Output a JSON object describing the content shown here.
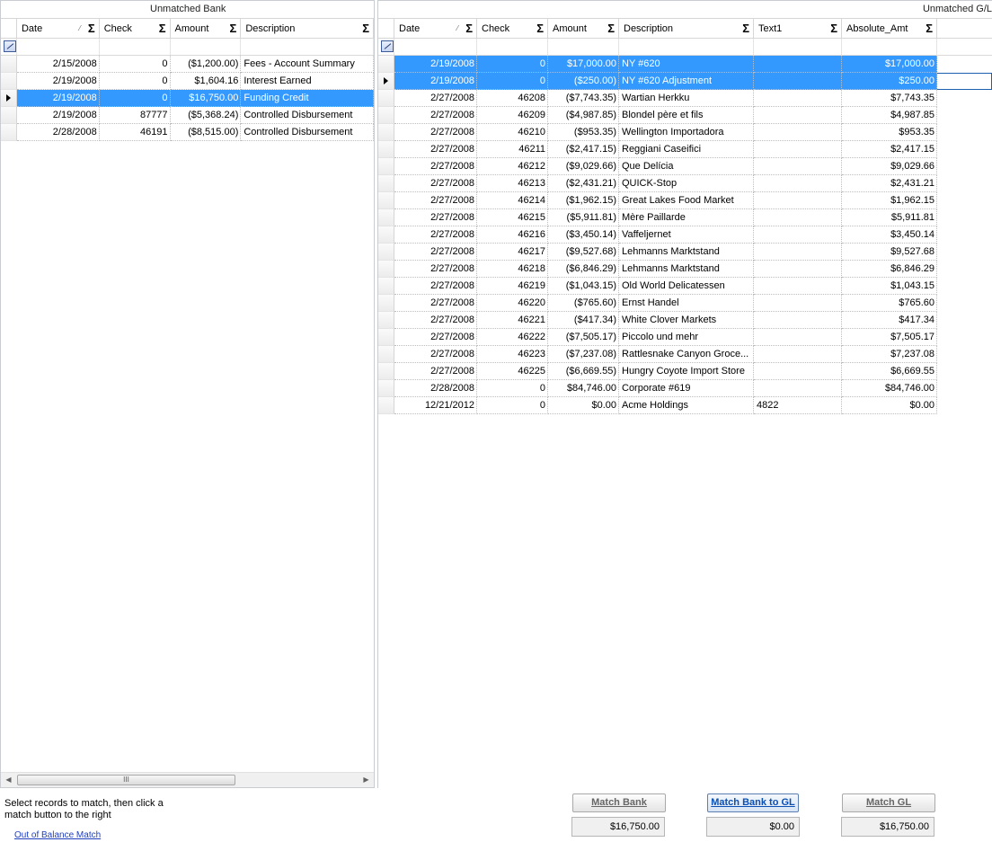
{
  "bank": {
    "title": "Unmatched Bank",
    "columns": [
      {
        "label": "Date",
        "sort": "⁄"
      },
      {
        "label": "Check",
        "sort": ""
      },
      {
        "label": "Amount",
        "sort": ""
      },
      {
        "label": "Description",
        "sort": ""
      }
    ],
    "sum_glyph": "Σ",
    "rows": [
      {
        "date": "2/15/2008",
        "check": "0",
        "amount": "($1,200.00)",
        "description": "Fees - Account Summary",
        "selected": false,
        "current": false
      },
      {
        "date": "2/19/2008",
        "check": "0",
        "amount": "$1,604.16",
        "description": "Interest Earned",
        "selected": false,
        "current": false
      },
      {
        "date": "2/19/2008",
        "check": "0",
        "amount": "$16,750.00",
        "description": "Funding Credit",
        "selected": true,
        "current": true
      },
      {
        "date": "2/19/2008",
        "check": "87777",
        "amount": "($5,368.24)",
        "description": "Controlled Disbursement",
        "selected": false,
        "current": false
      },
      {
        "date": "2/28/2008",
        "check": "46191",
        "amount": "($8,515.00)",
        "description": "Controlled Disbursement",
        "selected": false,
        "current": false
      }
    ],
    "scroll_thumb": "III"
  },
  "gl": {
    "title": "Unmatched G/L",
    "columns": [
      {
        "label": "Date",
        "sort": "⁄"
      },
      {
        "label": "Check",
        "sort": ""
      },
      {
        "label": "Amount",
        "sort": ""
      },
      {
        "label": "Description",
        "sort": ""
      },
      {
        "label": "Text1",
        "sort": ""
      },
      {
        "label": "Absolute_Amt",
        "sort": ""
      }
    ],
    "sum_glyph": "Σ",
    "rows": [
      {
        "date": "2/19/2008",
        "check": "0",
        "amount": "$17,000.00",
        "description": "NY #620",
        "text1": "",
        "abs": "$17,000.00",
        "selected": true,
        "current": false
      },
      {
        "date": "2/19/2008",
        "check": "0",
        "amount": "($250.00)",
        "description": "NY #620 Adjustment",
        "text1": "",
        "abs": "$250.00",
        "selected": true,
        "current": true
      },
      {
        "date": "2/27/2008",
        "check": "46208",
        "amount": "($7,743.35)",
        "description": "Wartian Herkku",
        "text1": "",
        "abs": "$7,743.35",
        "selected": false,
        "current": false
      },
      {
        "date": "2/27/2008",
        "check": "46209",
        "amount": "($4,987.85)",
        "description": "Blondel père et fils",
        "text1": "",
        "abs": "$4,987.85",
        "selected": false,
        "current": false
      },
      {
        "date": "2/27/2008",
        "check": "46210",
        "amount": "($953.35)",
        "description": "Wellington Importadora",
        "text1": "",
        "abs": "$953.35",
        "selected": false,
        "current": false
      },
      {
        "date": "2/27/2008",
        "check": "46211",
        "amount": "($2,417.15)",
        "description": "Reggiani Caseifici",
        "text1": "",
        "abs": "$2,417.15",
        "selected": false,
        "current": false
      },
      {
        "date": "2/27/2008",
        "check": "46212",
        "amount": "($9,029.66)",
        "description": "Que Delícia",
        "text1": "",
        "abs": "$9,029.66",
        "selected": false,
        "current": false
      },
      {
        "date": "2/27/2008",
        "check": "46213",
        "amount": "($2,431.21)",
        "description": "QUICK-Stop",
        "text1": "",
        "abs": "$2,431.21",
        "selected": false,
        "current": false
      },
      {
        "date": "2/27/2008",
        "check": "46214",
        "amount": "($1,962.15)",
        "description": "Great Lakes Food Market",
        "text1": "",
        "abs": "$1,962.15",
        "selected": false,
        "current": false
      },
      {
        "date": "2/27/2008",
        "check": "46215",
        "amount": "($5,911.81)",
        "description": "Mère Paillarde",
        "text1": "",
        "abs": "$5,911.81",
        "selected": false,
        "current": false
      },
      {
        "date": "2/27/2008",
        "check": "46216",
        "amount": "($3,450.14)",
        "description": "Vaffeljernet",
        "text1": "",
        "abs": "$3,450.14",
        "selected": false,
        "current": false
      },
      {
        "date": "2/27/2008",
        "check": "46217",
        "amount": "($9,527.68)",
        "description": "Lehmanns Marktstand",
        "text1": "",
        "abs": "$9,527.68",
        "selected": false,
        "current": false
      },
      {
        "date": "2/27/2008",
        "check": "46218",
        "amount": "($6,846.29)",
        "description": "Lehmanns Marktstand",
        "text1": "",
        "abs": "$6,846.29",
        "selected": false,
        "current": false
      },
      {
        "date": "2/27/2008",
        "check": "46219",
        "amount": "($1,043.15)",
        "description": "Old World Delicatessen",
        "text1": "",
        "abs": "$1,043.15",
        "selected": false,
        "current": false
      },
      {
        "date": "2/27/2008",
        "check": "46220",
        "amount": "($765.60)",
        "description": "Ernst Handel",
        "text1": "",
        "abs": "$765.60",
        "selected": false,
        "current": false
      },
      {
        "date": "2/27/2008",
        "check": "46221",
        "amount": "($417.34)",
        "description": "White Clover Markets",
        "text1": "",
        "abs": "$417.34",
        "selected": false,
        "current": false
      },
      {
        "date": "2/27/2008",
        "check": "46222",
        "amount": "($7,505.17)",
        "description": "Piccolo und mehr",
        "text1": "",
        "abs": "$7,505.17",
        "selected": false,
        "current": false
      },
      {
        "date": "2/27/2008",
        "check": "46223",
        "amount": "($7,237.08)",
        "description": "Rattlesnake Canyon Groce...",
        "text1": "",
        "abs": "$7,237.08",
        "selected": false,
        "current": false
      },
      {
        "date": "2/27/2008",
        "check": "46225",
        "amount": "($6,669.55)",
        "description": "Hungry Coyote Import Store",
        "text1": "",
        "abs": "$6,669.55",
        "selected": false,
        "current": false
      },
      {
        "date": "2/28/2008",
        "check": "0",
        "amount": "$84,746.00",
        "description": "Corporate #619",
        "text1": "",
        "abs": "$84,746.00",
        "selected": false,
        "current": false
      },
      {
        "date": "12/21/2012",
        "check": "0",
        "amount": "$0.00",
        "description": "Acme Holdings",
        "text1": "4822",
        "abs": "$0.00",
        "selected": false,
        "current": false
      }
    ]
  },
  "footer": {
    "instructions": "Select records to match, then click a match button to the right",
    "out_of_balance_link": "Out of Balance Match",
    "match_bank_label": "Match Bank",
    "match_bank_to_gl_label": "Match Bank to GL",
    "match_gl_label": "Match GL",
    "match_bank_value": "$16,750.00",
    "match_bank_to_gl_value": "$0.00",
    "match_gl_value": "$16,750.00"
  },
  "colors": {
    "selection": "#3399ff",
    "link": "#1f3fbf",
    "active_button_text": "#0b4fb3"
  },
  "icons": {
    "sum": "sigma-icon",
    "filter": "filter-edit-icon",
    "row_pointer": "row-indicator-arrow-icon",
    "scroll_left": "arrow-left-icon",
    "scroll_right": "arrow-right-icon"
  }
}
